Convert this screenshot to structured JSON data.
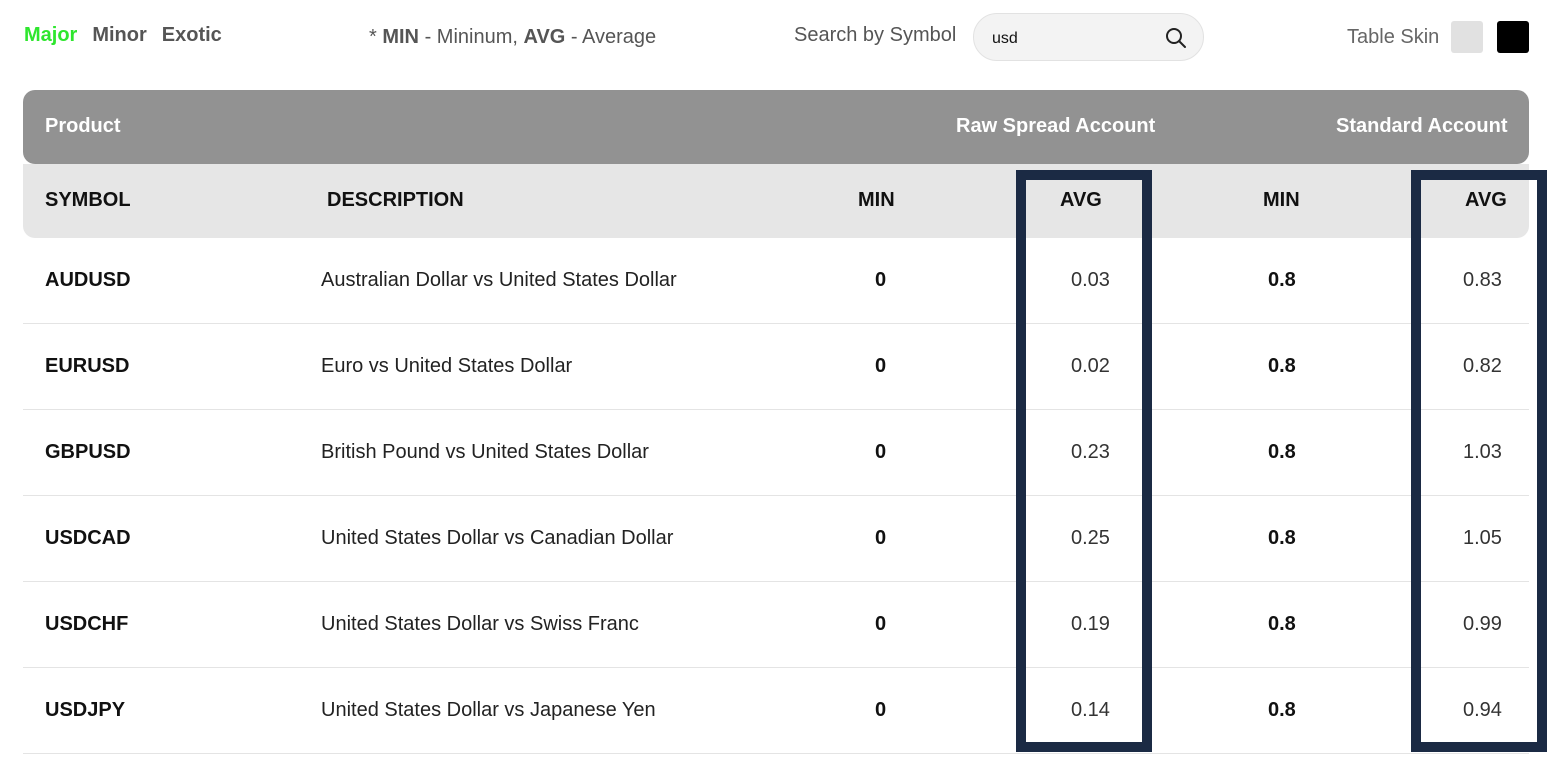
{
  "tabs": [
    {
      "label": "Major",
      "active": true
    },
    {
      "label": "Minor",
      "active": false
    },
    {
      "label": "Exotic",
      "active": false
    }
  ],
  "legend": {
    "prefix": "* ",
    "min_key": "MIN",
    "min_text": " - Mininum, ",
    "avg_key": "AVG",
    "avg_text": " - Average"
  },
  "search": {
    "label": "Search by Symbol",
    "value": "usd",
    "icon": "search-icon"
  },
  "skin": {
    "label": "Table Skin",
    "options": [
      "#e1e1e1",
      "#000000"
    ]
  },
  "table": {
    "group_headers": {
      "product": "Product",
      "raw": "Raw Spread Account",
      "standard": "Standard Account"
    },
    "columns": {
      "symbol": "SYMBOL",
      "description": "DESCRIPTION",
      "raw_min": "MIN",
      "raw_avg": "AVG",
      "std_min": "MIN",
      "std_avg": "AVG"
    },
    "rows": [
      {
        "symbol": "AUDUSD",
        "description": "Australian Dollar vs United States Dollar",
        "raw_min": "0",
        "raw_avg": "0.03",
        "std_min": "0.8",
        "std_avg": "0.83"
      },
      {
        "symbol": "EURUSD",
        "description": "Euro vs United States Dollar",
        "raw_min": "0",
        "raw_avg": "0.02",
        "std_min": "0.8",
        "std_avg": "0.82"
      },
      {
        "symbol": "GBPUSD",
        "description": "British Pound vs United States Dollar",
        "raw_min": "0",
        "raw_avg": "0.23",
        "std_min": "0.8",
        "std_avg": "1.03"
      },
      {
        "symbol": "USDCAD",
        "description": "United States Dollar vs Canadian Dollar",
        "raw_min": "0",
        "raw_avg": "0.25",
        "std_min": "0.8",
        "std_avg": "1.05"
      },
      {
        "symbol": "USDCHF",
        "description": "United States Dollar vs Swiss Franc",
        "raw_min": "0",
        "raw_avg": "0.19",
        "std_min": "0.8",
        "std_avg": "0.99"
      },
      {
        "symbol": "USDJPY",
        "description": "United States Dollar vs Japanese Yen",
        "raw_min": "0",
        "raw_avg": "0.14",
        "std_min": "0.8",
        "std_avg": "0.94"
      }
    ]
  },
  "colors": {
    "active_tab": "#2ee62e",
    "header_bg": "#929292",
    "subheader_bg": "#e6e6e6",
    "highlight": "#1b2a44"
  }
}
